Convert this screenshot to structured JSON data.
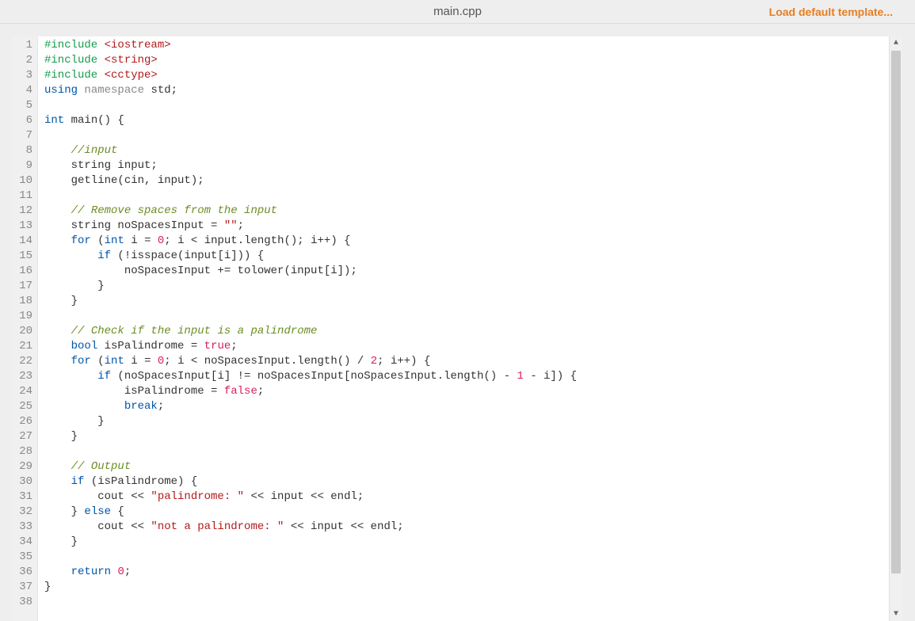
{
  "header": {
    "title": "main.cpp",
    "load_template_label": "Load default template..."
  },
  "editor": {
    "line_start": 1,
    "line_end": 38,
    "lines": [
      [
        {
          "c": "pp",
          "t": "#include"
        },
        {
          "c": "",
          "t": " "
        },
        {
          "c": "str",
          "t": "<iostream>"
        }
      ],
      [
        {
          "c": "pp",
          "t": "#include"
        },
        {
          "c": "",
          "t": " "
        },
        {
          "c": "str",
          "t": "<string>"
        }
      ],
      [
        {
          "c": "pp",
          "t": "#include"
        },
        {
          "c": "",
          "t": " "
        },
        {
          "c": "str",
          "t": "<cctype>"
        }
      ],
      [
        {
          "c": "kw",
          "t": "using"
        },
        {
          "c": "",
          "t": " "
        },
        {
          "c": "ns",
          "t": "namespace"
        },
        {
          "c": "",
          "t": " std;"
        }
      ],
      [],
      [
        {
          "c": "kw",
          "t": "int"
        },
        {
          "c": "",
          "t": " main() {"
        }
      ],
      [],
      [
        {
          "c": "",
          "t": "    "
        },
        {
          "c": "cmt",
          "t": "//input"
        }
      ],
      [
        {
          "c": "",
          "t": "    string input;"
        }
      ],
      [
        {
          "c": "",
          "t": "    getline(cin, input);"
        }
      ],
      [],
      [
        {
          "c": "",
          "t": "    "
        },
        {
          "c": "cmt",
          "t": "// Remove spaces from the input"
        }
      ],
      [
        {
          "c": "",
          "t": "    string noSpacesInput = "
        },
        {
          "c": "str",
          "t": "\"\""
        },
        {
          "c": "",
          "t": ";"
        }
      ],
      [
        {
          "c": "",
          "t": "    "
        },
        {
          "c": "kw",
          "t": "for"
        },
        {
          "c": "",
          "t": " ("
        },
        {
          "c": "kw",
          "t": "int"
        },
        {
          "c": "",
          "t": " i = "
        },
        {
          "c": "num",
          "t": "0"
        },
        {
          "c": "",
          "t": "; i < input.length(); i++) {"
        }
      ],
      [
        {
          "c": "",
          "t": "        "
        },
        {
          "c": "kw",
          "t": "if"
        },
        {
          "c": "",
          "t": " (!isspace(input[i])) {"
        }
      ],
      [
        {
          "c": "",
          "t": "            noSpacesInput += tolower(input[i]);"
        }
      ],
      [
        {
          "c": "",
          "t": "        }"
        }
      ],
      [
        {
          "c": "",
          "t": "    }"
        }
      ],
      [],
      [
        {
          "c": "",
          "t": "    "
        },
        {
          "c": "cmt",
          "t": "// Check if the input is a palindrome"
        }
      ],
      [
        {
          "c": "",
          "t": "    "
        },
        {
          "c": "kw",
          "t": "bool"
        },
        {
          "c": "",
          "t": " isPalindrome = "
        },
        {
          "c": "bool",
          "t": "true"
        },
        {
          "c": "",
          "t": ";"
        }
      ],
      [
        {
          "c": "",
          "t": "    "
        },
        {
          "c": "kw",
          "t": "for"
        },
        {
          "c": "",
          "t": " ("
        },
        {
          "c": "kw",
          "t": "int"
        },
        {
          "c": "",
          "t": " i = "
        },
        {
          "c": "num",
          "t": "0"
        },
        {
          "c": "",
          "t": "; i < noSpacesInput.length() / "
        },
        {
          "c": "num",
          "t": "2"
        },
        {
          "c": "",
          "t": "; i++) {"
        }
      ],
      [
        {
          "c": "",
          "t": "        "
        },
        {
          "c": "kw",
          "t": "if"
        },
        {
          "c": "",
          "t": " (noSpacesInput[i] != noSpacesInput[noSpacesInput.length() - "
        },
        {
          "c": "num",
          "t": "1"
        },
        {
          "c": "",
          "t": " - i]) {"
        }
      ],
      [
        {
          "c": "",
          "t": "            isPalindrome = "
        },
        {
          "c": "bool",
          "t": "false"
        },
        {
          "c": "",
          "t": ";"
        }
      ],
      [
        {
          "c": "",
          "t": "            "
        },
        {
          "c": "kw",
          "t": "break"
        },
        {
          "c": "",
          "t": ";"
        }
      ],
      [
        {
          "c": "",
          "t": "        }"
        }
      ],
      [
        {
          "c": "",
          "t": "    }"
        }
      ],
      [],
      [
        {
          "c": "",
          "t": "    "
        },
        {
          "c": "cmt",
          "t": "// Output"
        }
      ],
      [
        {
          "c": "",
          "t": "    "
        },
        {
          "c": "kw",
          "t": "if"
        },
        {
          "c": "",
          "t": " (isPalindrome) {"
        }
      ],
      [
        {
          "c": "",
          "t": "        cout << "
        },
        {
          "c": "str",
          "t": "\"palindrome: \""
        },
        {
          "c": "",
          "t": " << input << endl;"
        }
      ],
      [
        {
          "c": "",
          "t": "    } "
        },
        {
          "c": "kw",
          "t": "else"
        },
        {
          "c": "",
          "t": " {"
        }
      ],
      [
        {
          "c": "",
          "t": "        cout << "
        },
        {
          "c": "str",
          "t": "\"not a palindrome: \""
        },
        {
          "c": "",
          "t": " << input << endl;"
        }
      ],
      [
        {
          "c": "",
          "t": "    }"
        }
      ],
      [],
      [
        {
          "c": "",
          "t": "    "
        },
        {
          "c": "kw",
          "t": "return"
        },
        {
          "c": "",
          "t": " "
        },
        {
          "c": "num",
          "t": "0"
        },
        {
          "c": "",
          "t": ";"
        }
      ],
      [
        {
          "c": "",
          "t": "}"
        }
      ],
      []
    ]
  }
}
